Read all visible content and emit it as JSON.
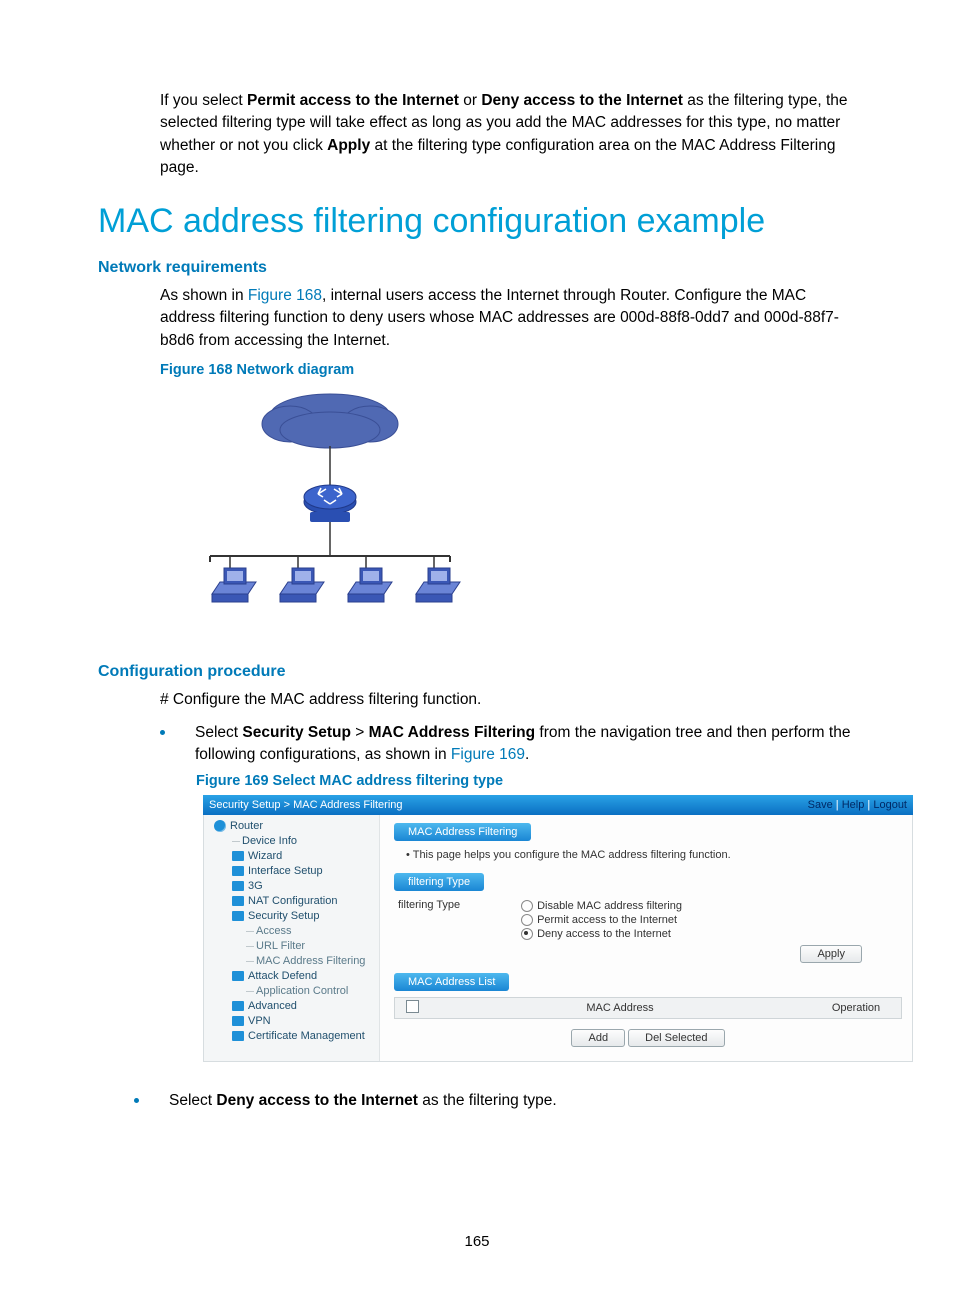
{
  "intro": {
    "p1_a": "If you select ",
    "p1_b1": "Permit access to the Internet",
    "p1_c": " or ",
    "p1_b2": "Deny access to the Internet",
    "p1_d": " as the filtering type, the selected filtering type will take effect as long as you add the MAC addresses for this type, no matter whether or not you click ",
    "p1_b3": "Apply",
    "p1_e": " at the filtering type configuration area on the MAC Address Filtering page."
  },
  "heading": "MAC address filtering configuration example",
  "netreq": {
    "title": "Network requirements",
    "p_a": "As shown in ",
    "p_link": "Figure 168",
    "p_b": ", internal users access the Internet through Router. Configure the MAC address filtering function to deny users whose MAC addresses are 000d-88f8-0dd7 and 000d-88f7-b8d6 from accessing the Internet."
  },
  "fig168_caption": "Figure 168 Network diagram",
  "diagram": {
    "router_label": "ROUTER"
  },
  "cfg": {
    "title": "Configuration procedure",
    "line1": "# Configure the MAC address filtering function.",
    "b1_a": "Select ",
    "b1_s1": "Security Setup",
    "b1_gt": " > ",
    "b1_s2": "MAC Address Filtering",
    "b1_b": " from the navigation tree and then perform the following configurations, as shown in ",
    "b1_link": "Figure 169",
    "b1_c": "."
  },
  "fig169_caption": "Figure 169 Select MAC address filtering type",
  "fig169": {
    "breadcrumb": "Security Setup > MAC Address Filtering",
    "links": {
      "save": "Save",
      "help": "Help",
      "logout": "Logout"
    },
    "nav": {
      "root": "Router",
      "items": [
        "Device Info",
        "Wizard",
        "Interface Setup",
        "3G",
        "NAT Configuration",
        "Security Setup",
        "Access",
        "URL Filter",
        "MAC Address Filtering",
        "Attack Defend",
        "Application Control",
        "Advanced",
        "VPN",
        "Certificate Management"
      ]
    },
    "pill1": "MAC Address Filtering",
    "note": "This page helps you configure the MAC address filtering function.",
    "pill2": "filtering Type",
    "ft_label": "filtering Type",
    "radios": [
      "Disable MAC address filtering",
      "Permit access to the Internet",
      "Deny access to the Internet"
    ],
    "apply": "Apply",
    "pill3": "MAC Address List",
    "th_mac": "MAC Address",
    "th_op": "Operation",
    "btn_add": "Add",
    "btn_del": "Del Selected"
  },
  "last_bullet_a": "Select ",
  "last_bullet_b": "Deny access to the Internet",
  "last_bullet_c": " as the filtering type.",
  "page_number": "165"
}
